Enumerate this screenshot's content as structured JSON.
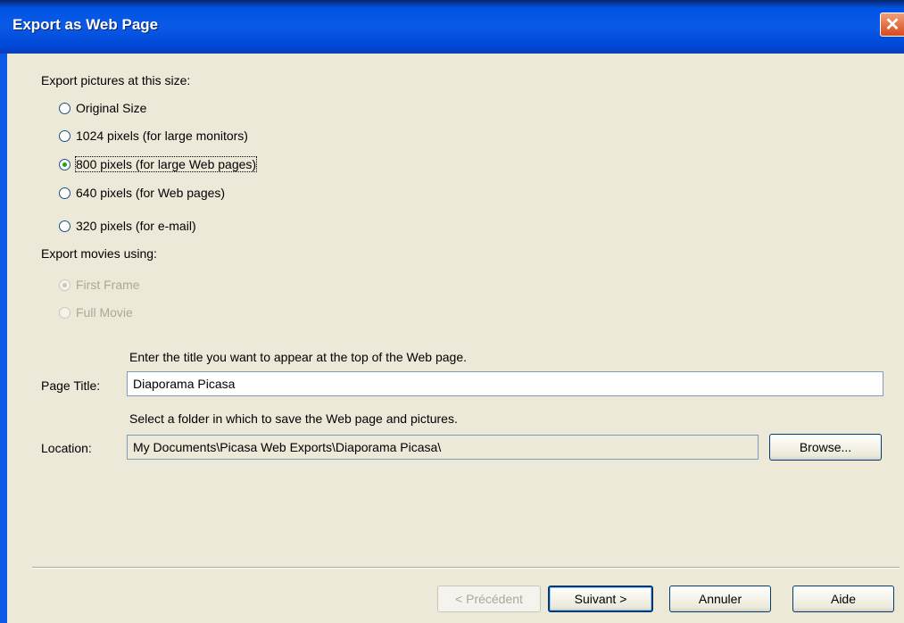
{
  "dialog": {
    "title": "Export as Web Page",
    "close_glyph": "✕"
  },
  "export_size": {
    "heading": "Export pictures at this size:",
    "options": [
      {
        "label": "Original Size",
        "checked": false
      },
      {
        "label": "1024 pixels (for large monitors)",
        "checked": false
      },
      {
        "label": "800 pixels (for large Web pages)",
        "checked": true
      },
      {
        "label": "640 pixels (for Web pages)",
        "checked": false
      },
      {
        "label": "320 pixels (for e-mail)",
        "checked": false
      }
    ]
  },
  "export_movies": {
    "heading": "Export movies using:",
    "options": [
      {
        "label": "First Frame",
        "checked": true,
        "disabled": true
      },
      {
        "label": "Full Movie",
        "checked": false,
        "disabled": true
      }
    ]
  },
  "page_title": {
    "hint": "Enter the title you want to appear at the top of the Web page.",
    "label": "Page Title:",
    "value": "Diaporama Picasa"
  },
  "location": {
    "hint": "Select a folder in which to save the Web page and pictures.",
    "label": "Location:",
    "value": "My Documents\\Picasa Web Exports\\Diaporama Picasa\\",
    "browse_label": "Browse..."
  },
  "footer": {
    "prev_label": "< Précédent",
    "next_label": "Suivant >",
    "cancel_label": "Annuler",
    "help_label": "Aide"
  },
  "colors": {
    "titlebar": "#0054e3",
    "dialog_bg": "#ece9d8",
    "selected_radio": "#21a121"
  }
}
